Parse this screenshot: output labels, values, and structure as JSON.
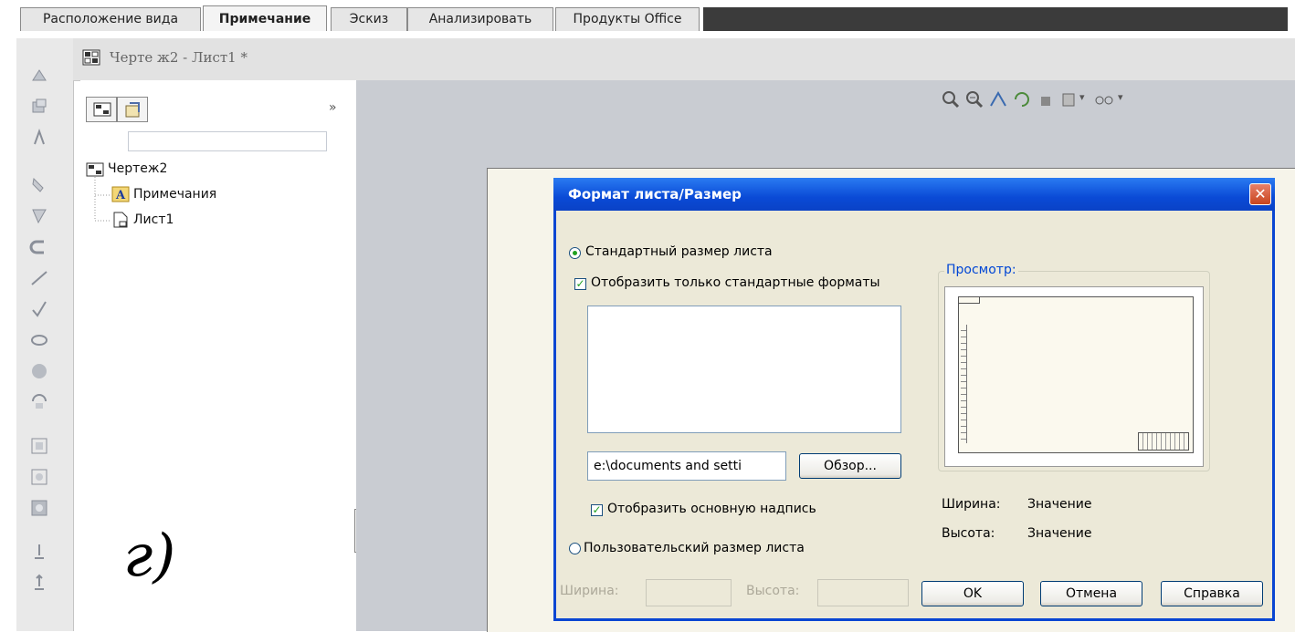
{
  "tabs": [
    {
      "label": "Расположение вида",
      "active": false
    },
    {
      "label": "Примечание",
      "active": true
    },
    {
      "label": "Эскиз",
      "active": false
    },
    {
      "label": "Анализировать",
      "active": false
    },
    {
      "label": "Продукты Office",
      "active": false
    }
  ],
  "document": {
    "title": "Черте ж2 - Лист1 *"
  },
  "feature_manager": {
    "expand_label": "»",
    "tree": {
      "root": "Чертеж2",
      "children": [
        "Примечания",
        "Лист1"
      ]
    }
  },
  "annotation": {
    "handwritten": "г)"
  },
  "dialog": {
    "title": "Формат листа/Размер",
    "close_label": "✕",
    "standard_radio": {
      "label": "Стандартный размер листа",
      "selected": true
    },
    "only_standard_check": {
      "label": "Отобразить только стандартные форматы",
      "checked": true
    },
    "path_field": {
      "value": "e:\\documents and setti"
    },
    "browse_button": "Обзор...",
    "show_title_block": {
      "label": "Отобразить основную надпись",
      "checked": true
    },
    "custom_radio": {
      "label": "Пользовательский размер листа",
      "selected": false
    },
    "custom_width_label": "Ширина:",
    "custom_height_label": "Высота:",
    "preview": {
      "legend": "Просмотр:"
    },
    "width": {
      "label": "Ширина:",
      "value": "Значение"
    },
    "height": {
      "label": "Высота:",
      "value": "Значение"
    },
    "ok_button": "OK",
    "cancel_button": "Отмена",
    "help_button": "Справка"
  },
  "colors": {
    "accent": "#0a46d2",
    "check": "#21a121"
  }
}
